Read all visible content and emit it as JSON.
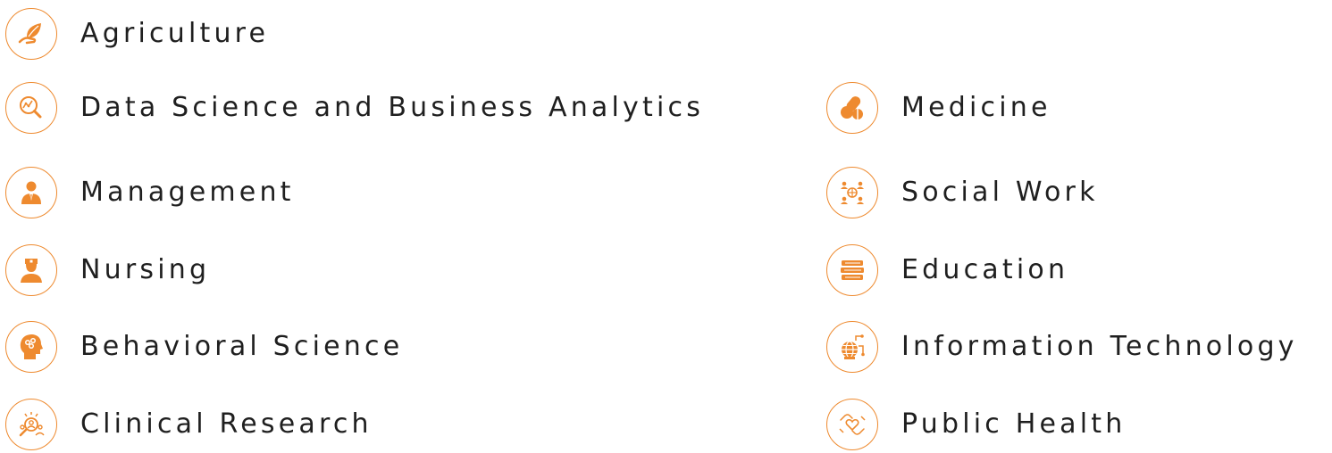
{
  "accent_color": "#ee8a2f",
  "subjects": [
    {
      "label": "Agriculture",
      "icon": "leaf-hand-icon"
    },
    {
      "label": "Data Science and Business Analytics",
      "icon": "analytics-magnifier-icon"
    },
    {
      "label": "Management",
      "icon": "businessman-icon"
    },
    {
      "label": "Nursing",
      "icon": "nurse-icon"
    },
    {
      "label": "Behavioral Science",
      "icon": "brain-head-icon"
    },
    {
      "label": "Clinical Research",
      "icon": "research-people-icon"
    },
    {
      "label": "Medicine",
      "icon": "pills-icon"
    },
    {
      "label": "Social Work",
      "icon": "social-network-icon"
    },
    {
      "label": "Education",
      "icon": "books-icon"
    },
    {
      "label": "Information Technology",
      "icon": "globe-network-icon"
    },
    {
      "label": "Public Health",
      "icon": "heart-hands-icon"
    }
  ]
}
